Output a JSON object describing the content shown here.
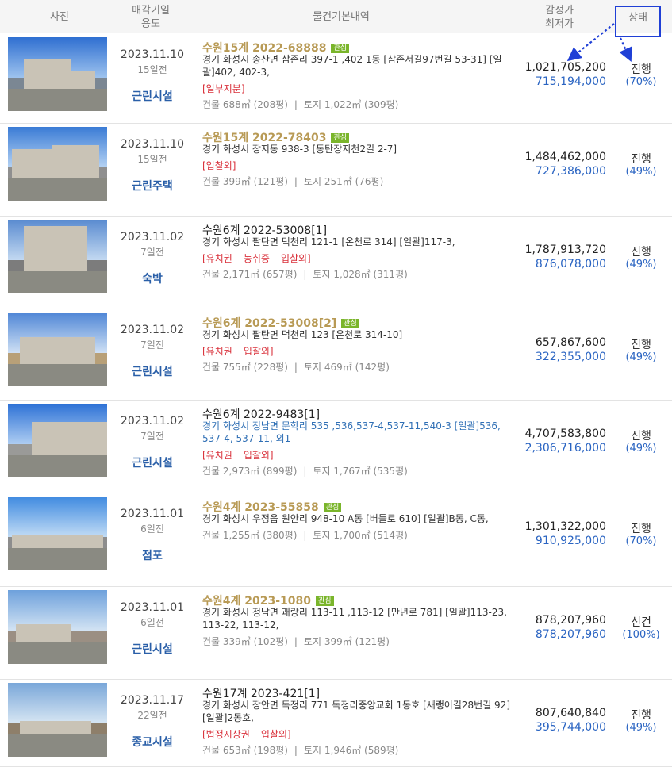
{
  "header": {
    "photo": "사진",
    "date_line1": "매각기일",
    "date_line2": "용도",
    "info": "물건기본내역",
    "price_line1": "감정가",
    "price_line2": "최저가",
    "status": "상태"
  },
  "colors": {
    "case_gold": "#b89a55",
    "tag_green": "#7ab52b",
    "flag_red": "#d9303a",
    "link_blue": "#2a64c2",
    "highlight_box": "#1f3fd6"
  },
  "items": [
    {
      "date": "2023.11.10",
      "ago": "15일전",
      "usage": "근린시설",
      "case": "수원15계 2022-68888",
      "tag": "관심",
      "addr": "경기 화성시 송산면 삼존리 397-1 ,402 1동 [삼존서길97번길 53-31] [일괄]402, 402-3,",
      "flags": [
        "[일부지분]"
      ],
      "building": "건물 688㎡ (208평)",
      "land": "토지 1,022㎡ (309평)",
      "appraisal": "1,021,705,200",
      "minbid": "715,194,000",
      "status": "진행",
      "rate": "(70%)"
    },
    {
      "date": "2023.11.10",
      "ago": "15일전",
      "usage": "근린주택",
      "case": "수원15계 2022-78403",
      "tag": "관심",
      "addr": "경기 화성시 장지동 938-3 [동탄장지천2길 2-7]",
      "flags": [
        "[입찰외]"
      ],
      "building": "건물 399㎡ (121평)",
      "land": "토지 251㎡ (76평)",
      "appraisal": "1,484,462,000",
      "minbid": "727,386,000",
      "status": "진행",
      "rate": "(49%)"
    },
    {
      "date": "2023.11.02",
      "ago": "7일전",
      "usage": "숙박",
      "case": "수원6계 2022-53008[1]",
      "tag": "",
      "addr": "경기 화성시 팔탄면 덕천리 121-1 [온천로 314] [일괄]117-3,",
      "flags": [
        "[유치권",
        "농취증",
        "입찰외]"
      ],
      "building": "건물 2,171㎡ (657평)",
      "land": "토지 1,028㎡ (311평)",
      "appraisal": "1,787,913,720",
      "minbid": "876,078,000",
      "status": "진행",
      "rate": "(49%)"
    },
    {
      "date": "2023.11.02",
      "ago": "7일전",
      "usage": "근린시설",
      "case": "수원6계 2022-53008[2]",
      "tag": "관심",
      "addr": "경기 화성시 팔탄면 덕천리 123 [온천로 314-10]",
      "flags": [
        "[유치권",
        "입찰외]"
      ],
      "building": "건물 755㎡ (228평)",
      "land": "토지 469㎡ (142평)",
      "appraisal": "657,867,600",
      "minbid": "322,355,000",
      "status": "진행",
      "rate": "(49%)"
    },
    {
      "date": "2023.11.02",
      "ago": "7일전",
      "usage": "근린시설",
      "case": "수원6계 2022-9483[1]",
      "tag": "",
      "addr": "경기 화성시 정남면 문학리 535 ,536,537-4,537-11,540-3 [일괄]536, 537-4, 537-11, 외1",
      "flags": [
        "[유치권",
        "입찰외]"
      ],
      "building": "건물 2,973㎡ (899평)",
      "land": "토지 1,767㎡ (535평)",
      "appraisal": "4,707,583,800",
      "minbid": "2,306,716,000",
      "status": "진행",
      "rate": "(49%)"
    },
    {
      "date": "2023.11.01",
      "ago": "6일전",
      "usage": "점포",
      "case": "수원4계 2023-55858",
      "tag": "관심",
      "addr": "경기 화성시 우정읍 원안리 948-10 A동 [버들로 610] [일괄]B동, C동,",
      "flags": [],
      "building": "건물 1,255㎡ (380평)",
      "land": "토지 1,700㎡ (514평)",
      "appraisal": "1,301,322,000",
      "minbid": "910,925,000",
      "status": "진행",
      "rate": "(70%)"
    },
    {
      "date": "2023.11.01",
      "ago": "6일전",
      "usage": "근린시설",
      "case": "수원4계 2023-1080",
      "tag": "관심",
      "addr": "경기 화성시 정남면 괘랑리 113-11 ,113-12 [만년로 781] [일괄]113-23, 113-22, 113-12,",
      "flags": [],
      "building": "건물 339㎡ (102평)",
      "land": "토지 399㎡ (121평)",
      "appraisal": "878,207,960",
      "minbid": "878,207,960",
      "status": "신건",
      "rate": "(100%)"
    },
    {
      "date": "2023.11.17",
      "ago": "22일전",
      "usage": "종교시설",
      "case": "수원17계 2023-421[1]",
      "tag": "",
      "addr": "경기 화성시 장안면 독정리 771 독정리중앙교회 1동호 [새랭이길28번길 92] [일괄]2동호,",
      "flags": [
        "[법정지상권",
        "입찰외]"
      ],
      "building": "건물 653㎡ (198평)",
      "land": "토지 1,946㎡ (589평)",
      "appraisal": "807,640,840",
      "minbid": "395,744,000",
      "status": "진행",
      "rate": "(49%)"
    }
  ]
}
